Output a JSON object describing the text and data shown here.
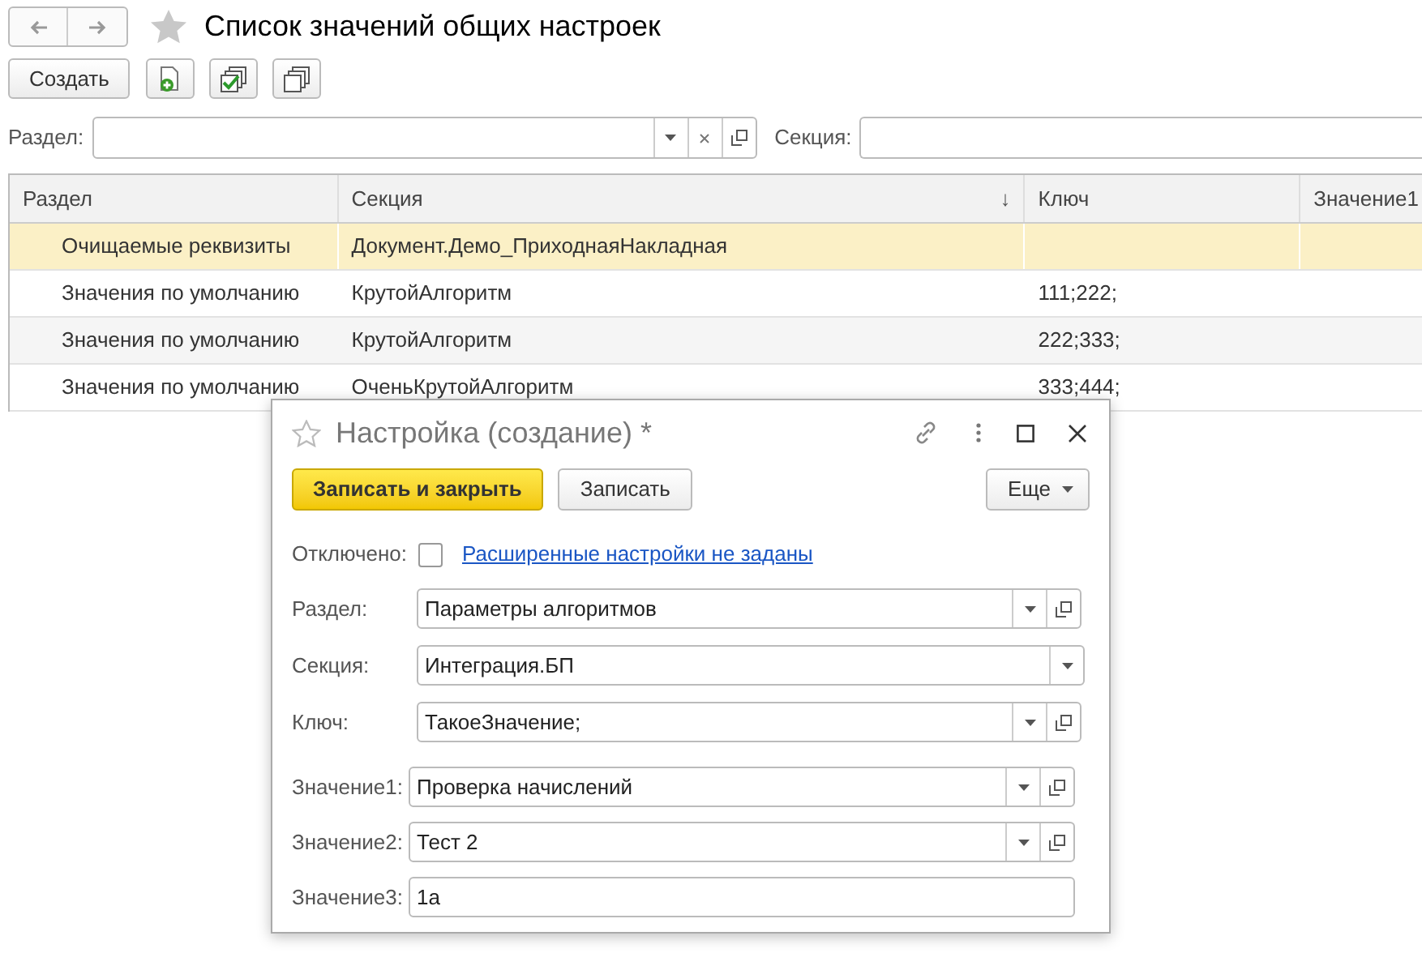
{
  "title": "Список значений общих настроек",
  "toolbar": {
    "create_button": "Создать"
  },
  "filters": [
    {
      "label": "Раздел:",
      "kind": "combo"
    },
    {
      "label": "Секция:",
      "kind": "plain"
    }
  ],
  "table": {
    "columns": [
      {
        "label": "Раздел"
      },
      {
        "label": "Секция",
        "sort_mark": "↓"
      },
      {
        "label": "Ключ"
      },
      {
        "label": "Значение1"
      }
    ],
    "rows": [
      {
        "selected": true,
        "cells": [
          "Очищаемые реквизиты",
          "Документ.Демо_ПриходнаяНакладная",
          "",
          ""
        ]
      },
      {
        "selected": false,
        "cells": [
          "Значения по умолчанию",
          "КрутойАлгоритм",
          "111;222;",
          ""
        ]
      },
      {
        "selected": false,
        "cells": [
          "Значения по умолчанию",
          "КрутойАлгоритм",
          "222;333;",
          ""
        ]
      },
      {
        "selected": false,
        "cells": [
          "Значения по умолчанию",
          "ОченьКрутойАлгоритм",
          "333;444;",
          ""
        ]
      }
    ]
  },
  "dialog": {
    "title": "Настройка (создание) *",
    "buttons": [
      {
        "label": "Записать и закрыть",
        "kind": "primary"
      },
      {
        "label": "Записать",
        "kind": "normal"
      },
      {
        "label": "Еще",
        "kind": "menu"
      }
    ],
    "disabled": {
      "label": "Отключено:",
      "checked": false
    },
    "link": "Расширенные настройки не заданы",
    "fields": [
      {
        "label": "Раздел:",
        "value": "Параметры алгоритмов",
        "kind": "combo-open"
      },
      {
        "label": "Секция:",
        "value": "Интеграция.БП",
        "kind": "combo"
      },
      {
        "label": "Ключ:",
        "value": "ТакоеЗначение;",
        "kind": "combo-open"
      },
      {
        "label": "Значение1:",
        "value": "Проверка начислений",
        "kind": "combo-open"
      },
      {
        "label": "Значение2:",
        "value": "Тест 2",
        "kind": "combo-open"
      },
      {
        "label": "Значение3:",
        "value": "1a",
        "kind": "text"
      }
    ]
  }
}
